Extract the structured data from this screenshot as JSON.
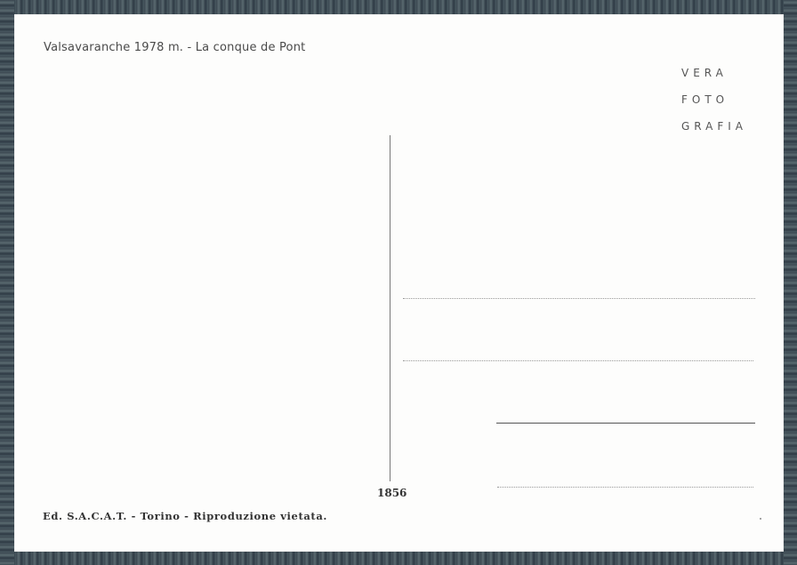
{
  "postcard": {
    "caption": "Valsavaranche 1978 m. - La conque de Pont",
    "brand": [
      "VERA",
      "FOTO",
      "GRAFIA"
    ],
    "serial_number": "1856",
    "publisher": "Ed. S.A.C.A.T. - Torino - Riproduzione vietata."
  },
  "colors": {
    "card": "#fdfdfc",
    "ink": "#4a4a4a",
    "frame": "#3c4a55"
  }
}
